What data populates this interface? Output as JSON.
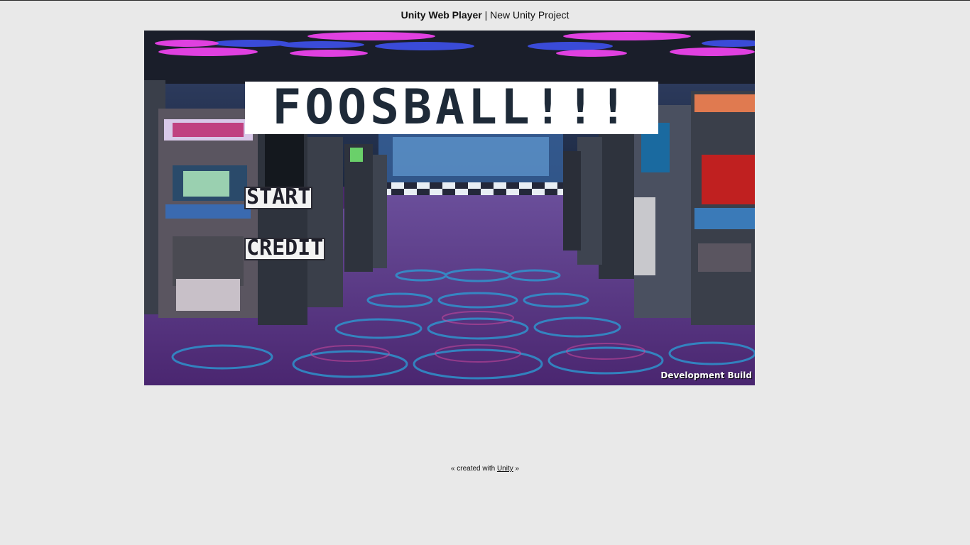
{
  "header": {
    "app_name": "Unity Web Player",
    "separator": " | ",
    "project_name": "New Unity Project"
  },
  "game": {
    "title": "FOOSBALL!!!",
    "menu": {
      "start_label": "START",
      "credit_label": "CREDIT"
    },
    "build_label": "Development Build",
    "colors": {
      "floor": "#5a2f86",
      "ceiling": "#1a1e2a",
      "neon_pink": "#e040e0",
      "neon_blue": "#3a4bd8",
      "carpet_ring": "#2aa0d8"
    }
  },
  "footer": {
    "prefix": "« created with ",
    "link_label": "Unity",
    "suffix": " »"
  }
}
